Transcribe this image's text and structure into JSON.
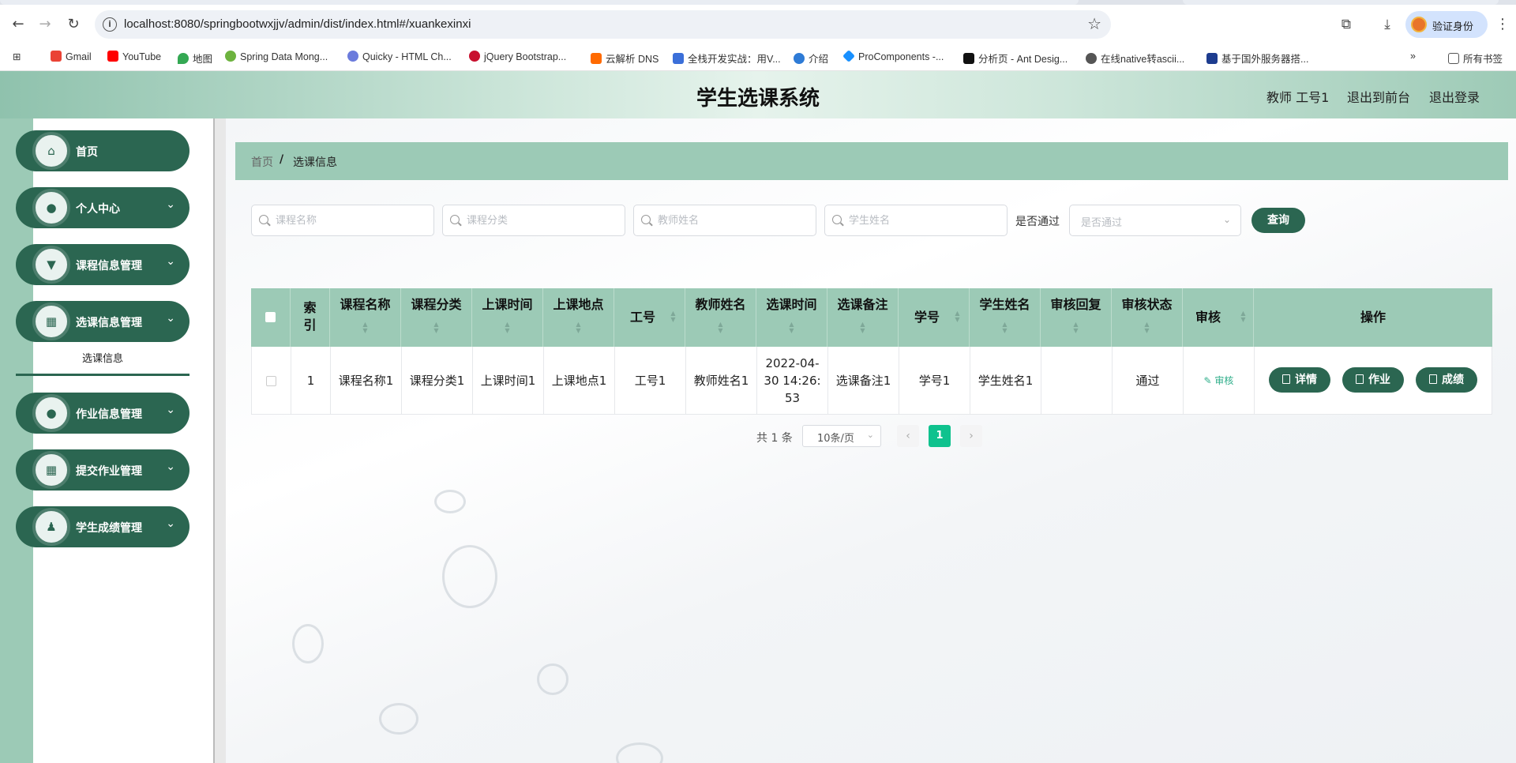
{
  "browser": {
    "url": "localhost:8080/springbootwxjjv/admin/dist/index.html#/xuankexinxi",
    "profile_label": "验证身份",
    "bookmarks": [
      "Gmail",
      "YouTube",
      "地图",
      "Spring Data Mong...",
      "Quicky - HTML Ch...",
      "jQuery Bootstrap...",
      "云解析 DNS",
      "全栈开发实战：用V...",
      "介绍",
      "ProComponents -...",
      "分析页 - Ant Desig...",
      "在线native转ascii...",
      "基于国外服务器搭..."
    ],
    "all_bookmarks": "所有书签",
    "colors": {
      "omnibox": "#eef1f6",
      "profile": "#d3e3fd"
    }
  },
  "header": {
    "title": "学生选课系统",
    "user": "教师 工号1",
    "to_front": "退出到前台",
    "logout": "退出登录"
  },
  "sidebar": {
    "items": [
      {
        "label": "首页",
        "icon": "home-icon"
      },
      {
        "label": "个人中心",
        "icon": "user-icon"
      },
      {
        "label": "课程信息管理",
        "icon": "course-icon"
      },
      {
        "label": "选课信息管理",
        "icon": "grid-icon"
      },
      {
        "label": "作业信息管理",
        "icon": "user-icon"
      },
      {
        "label": "提交作业管理",
        "icon": "grid-icon"
      },
      {
        "label": "学生成绩管理",
        "icon": "person-icon"
      }
    ],
    "submenu_active": "选课信息"
  },
  "breadcrumb": {
    "home": "首页",
    "sep": "/",
    "current": "选课信息"
  },
  "search": {
    "course_name_ph": "课程名称",
    "course_category_ph": "课程分类",
    "teacher_name_ph": "教师姓名",
    "student_name_ph": "学生姓名",
    "passed_label": "是否通过",
    "passed_ph": "是否通过",
    "query_button": "查询"
  },
  "table": {
    "columns": [
      "索引",
      "课程名称",
      "课程分类",
      "上课时间",
      "上课地点",
      "工号",
      "教师姓名",
      "选课时间",
      "选课备注",
      "学号",
      "学生姓名",
      "审核回复",
      "审核状态",
      "审核",
      "操作"
    ],
    "index_col_line1": "索",
    "index_col_line2": "引",
    "rows": [
      {
        "index": "1",
        "course_name": "课程名称1",
        "course_category": "课程分类1",
        "class_time": "上课时间1",
        "class_place": "上课地点1",
        "work_no": "工号1",
        "teacher_name": "教师姓名1",
        "select_time": "2022-04-30 14:26:53",
        "remark": "选课备注1",
        "student_no": "学号1",
        "student_name": "学生姓名1",
        "audit_reply": "",
        "audit_status": "通过",
        "audit_link": "审核",
        "btn_detail": "详情",
        "btn_homework": "作业",
        "btn_score": "成绩"
      }
    ]
  },
  "pagination": {
    "total": "共 1 条",
    "page_size": "10条/页",
    "current": "1"
  },
  "colors": {
    "primary": "#2b6651",
    "header_green": "#9ccab6",
    "page_active": "#0fc28e"
  }
}
